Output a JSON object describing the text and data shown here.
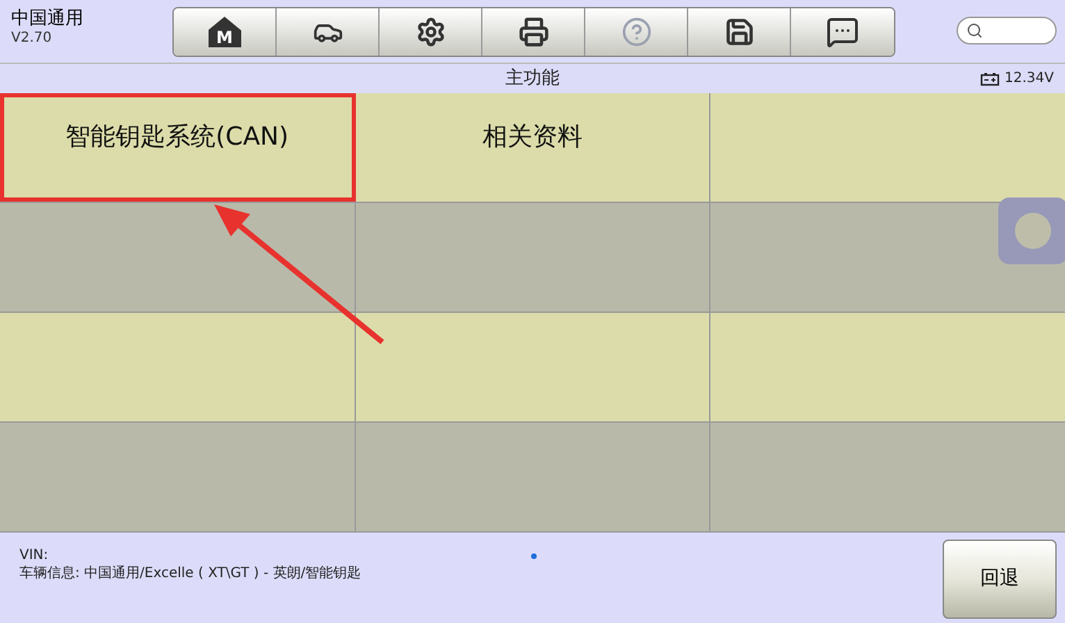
{
  "app": {
    "title": "中国通用",
    "version": "V2.70"
  },
  "toolbar": [
    {
      "kind": "home",
      "label": "M",
      "disabled": false
    },
    {
      "kind": "vehicle",
      "disabled": false
    },
    {
      "kind": "settings",
      "disabled": false
    },
    {
      "kind": "print",
      "disabled": false
    },
    {
      "kind": "help",
      "disabled": true
    },
    {
      "kind": "save",
      "disabled": false
    },
    {
      "kind": "message",
      "disabled": false
    }
  ],
  "header": {
    "title": "主功能",
    "voltage": "12.34V"
  },
  "grid": [
    {
      "cells": [
        {
          "label": "智能钥匙系统(CAN)",
          "highlighted": true
        },
        {
          "label": "相关资料",
          "highlighted": false
        },
        {
          "highlighted": false
        }
      ]
    },
    {
      "cells": [
        {
          "highlighted": false
        },
        {
          "highlighted": false
        },
        {
          "highlighted": false
        }
      ]
    },
    {
      "cells": [
        {
          "highlighted": false
        },
        {
          "highlighted": false
        },
        {
          "highlighted": false
        }
      ]
    },
    {
      "cells": [
        {
          "highlighted": false
        },
        {
          "highlighted": false
        },
        {
          "highlighted": false
        }
      ]
    }
  ],
  "footer": {
    "vin": "VIN:",
    "vehicle_info": "车辆信息: 中国通用/Excelle ( XT\\GT ) - 英朗/智能钥匙",
    "back_button": "回退"
  }
}
